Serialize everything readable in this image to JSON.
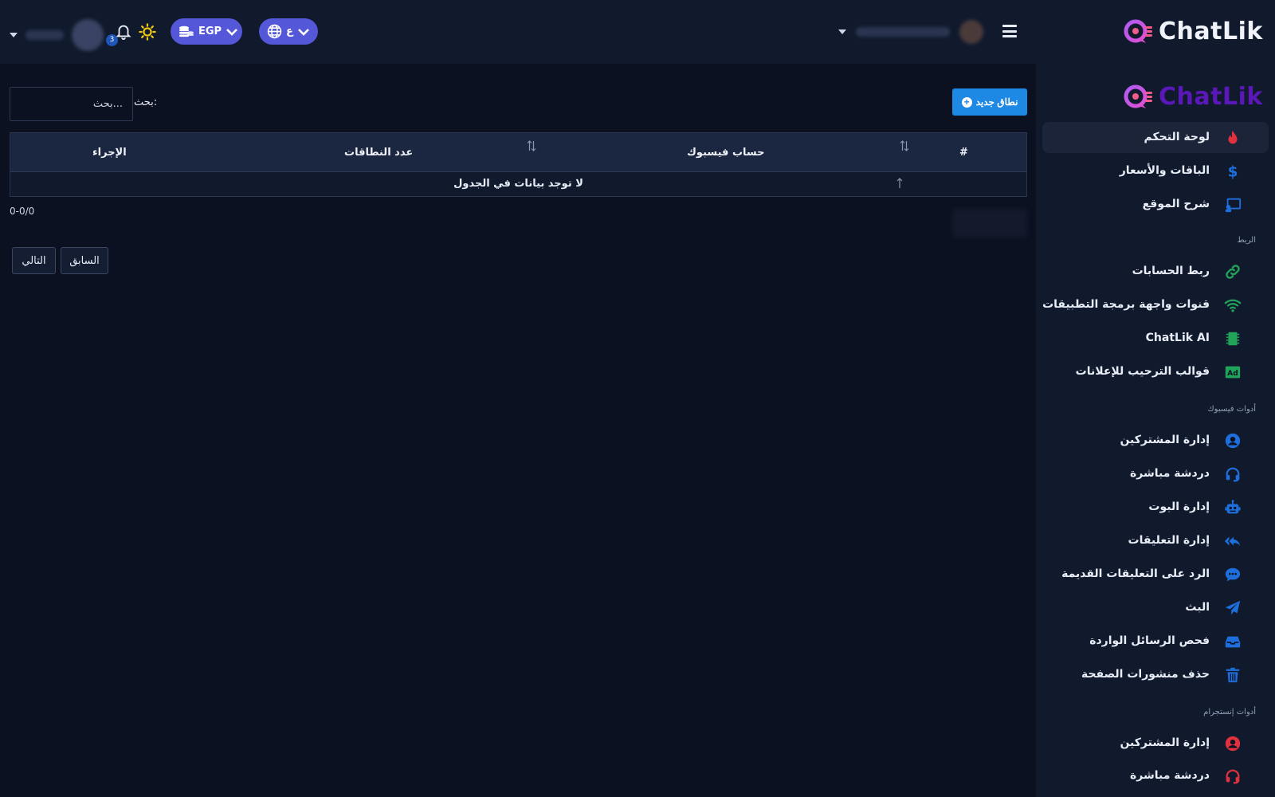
{
  "brand": {
    "name": "ChatLik"
  },
  "topbar": {
    "notification_count": "3",
    "currency_label": "EGP",
    "language_label": "ع"
  },
  "sidebar": {
    "items": [
      {
        "label": "لوحة التحكم",
        "icon": "fire-icon",
        "color": "#e0313f",
        "active": true
      },
      {
        "label": "الباقات والأسعار",
        "icon": "dollar-icon",
        "color": "#1e6fdc"
      },
      {
        "label": "شرح الموقع",
        "icon": "presentation-icon",
        "color": "#1e6fdc"
      }
    ],
    "section_link": "الربط",
    "link_items": [
      {
        "label": "ربط الحسابات",
        "icon": "link-icon",
        "color": "#22a35a"
      },
      {
        "label": "قنوات واجهة برمجة التطبيقات",
        "icon": "wifi-icon",
        "color": "#22a35a"
      },
      {
        "label": "ChatLik AI",
        "icon": "chip-icon",
        "color": "#22a35a"
      },
      {
        "label": "قوالب الترحيب للإعلانات",
        "icon": "ad-icon",
        "color": "#22a35a"
      }
    ],
    "section_facebook": "أدوات فيسبوك",
    "facebook_items": [
      {
        "label": "إدارة المشتركين",
        "icon": "user-circle-icon",
        "color": "#1e6fdc"
      },
      {
        "label": "دردشة مباشرة",
        "icon": "headset-icon",
        "color": "#1e6fdc"
      },
      {
        "label": "إدارة البوت",
        "icon": "robot-icon",
        "color": "#1e6fdc"
      },
      {
        "label": "إدارة التعليقات",
        "icon": "reply-all-icon",
        "color": "#1e6fdc"
      },
      {
        "label": "الرد على التعليقات القديمة",
        "icon": "comment-dots-icon",
        "color": "#1e6fdc"
      },
      {
        "label": "البث",
        "icon": "paper-plane-icon",
        "color": "#1e6fdc"
      },
      {
        "label": "فحص الرسائل الواردة",
        "icon": "inbox-icon",
        "color": "#1e6fdc"
      },
      {
        "label": "حذف منشورات الصفحة",
        "icon": "trash-icon",
        "color": "#1e6fdc"
      }
    ],
    "section_instagram": "أدوات إنستجرام",
    "instagram_items": [
      {
        "label": "إدارة المشتركين",
        "icon": "user-circle-icon",
        "color": "#e0313f"
      },
      {
        "label": "دردشة مباشرة",
        "icon": "headset-icon",
        "color": "#e0313f"
      }
    ]
  },
  "main": {
    "new_button_label": "نطاق جديد",
    "search_label": "بحث:",
    "search_placeholder": "بحث...",
    "table": {
      "columns": [
        "#",
        "حساب فيسبوك",
        "عدد النطاقات",
        "الإجراء"
      ],
      "empty_message": "لا توجد بيانات في الجدول"
    },
    "page_info": "0-0/0",
    "prev_label": "السابق",
    "next_label": "التالي"
  }
}
